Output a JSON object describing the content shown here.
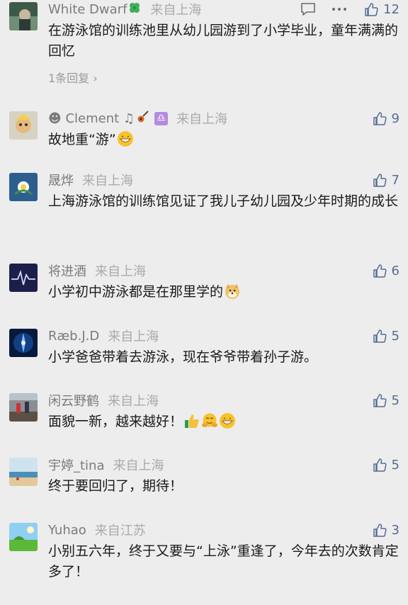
{
  "comments": [
    {
      "name": "White Dwarf",
      "name_emoji": "four-leaf-clover-emoji",
      "location": "来自上海",
      "likes": "12",
      "text": "在游泳馆的训练池里从幼儿园游到了小学毕业，童年满满的回忆",
      "replies": "1条回复"
    },
    {
      "name": "☻ Clement ♫",
      "name_emoji": "guitar-emoji",
      "name_badge": "♎",
      "location": "来自上海",
      "likes": "9",
      "text": "故地重“游”",
      "text_emojis": [
        "grinning-emoji"
      ]
    },
    {
      "name": "晟烨",
      "location": "来自上海",
      "likes": "7",
      "text": "上海游泳馆的训练馆见证了我儿子幼儿园及少年时期的成长"
    },
    {
      "name": "将进酒",
      "location": "来自上海",
      "likes": "6",
      "text": "小学初中游泳都是在那里学的",
      "text_emojis": [
        "doge-emoji"
      ]
    },
    {
      "name": "Ræb.J.D",
      "location": "来自上海",
      "likes": "5",
      "text": "小学爸爸带着去游泳，现在爷爷带着孙子游。"
    },
    {
      "name": "闲云野鹤",
      "location": "来自上海",
      "likes": "5",
      "text": "面貌一新，越来越好！",
      "text_emojis": [
        "thumbs-up-emoji",
        "hug-emoji",
        "grinning-emoji"
      ]
    },
    {
      "name": "宇婷_tina",
      "location": "来自上海",
      "likes": "5",
      "text": "终于要回归了，期待！"
    },
    {
      "name": "Yuhao",
      "location": "来自江苏",
      "likes": "3",
      "text": "小别五六年，终于又要与“上泳”重逢了，今年去的次数肯定多了！"
    }
  ],
  "icons": {
    "reply": "comment-icon",
    "more": "more-icon",
    "like": "thumbs-up-icon"
  },
  "colors": {
    "like_count": "#576b95",
    "name": "#7b7b7b",
    "location": "#aaaaaa"
  }
}
